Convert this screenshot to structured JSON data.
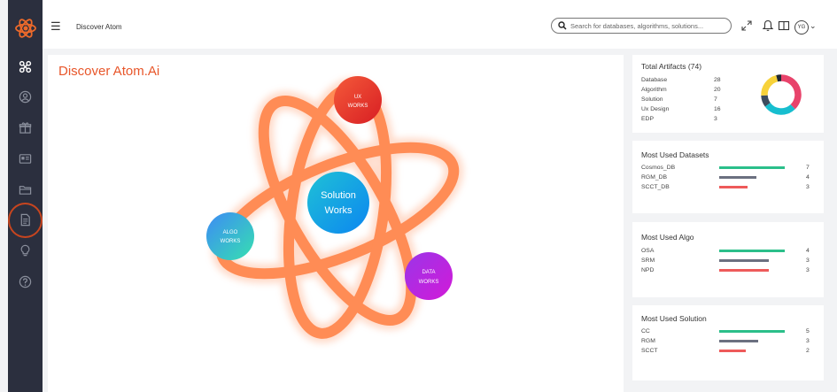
{
  "header": {
    "breadcrumb": "Discover Atom",
    "search_placeholder": "Search for databases, algorithms, solutions...",
    "avatar_initials": "YG"
  },
  "main": {
    "title": "Discover Atom.Ai",
    "nodes": {
      "center": [
        "Solution",
        "Works"
      ],
      "ux": [
        "UX",
        "WORKS"
      ],
      "algo": [
        "ALGO",
        "WORKS"
      ],
      "data": [
        "DATA",
        "WORKS"
      ]
    }
  },
  "artifacts": {
    "title": "Total Artifacts (74)",
    "items": [
      {
        "label": "Database",
        "value": "28",
        "color": "#e8436b"
      },
      {
        "label": "Algorithm",
        "value": "20",
        "color": "#17becf"
      },
      {
        "label": "Solution",
        "value": "7",
        "color": "#3c4c5e"
      },
      {
        "label": "Ux Design",
        "value": "16",
        "color": "#f7d23a"
      },
      {
        "label": "EDP",
        "value": "3",
        "color": "#1f2833"
      }
    ]
  },
  "datasets": {
    "title": "Most Used Datasets",
    "items": [
      {
        "label": "Cosmos_DB",
        "value": "7",
        "color": "#2bbf8a"
      },
      {
        "label": "RGM_DB",
        "value": "4",
        "color": "#6b7080"
      },
      {
        "label": "SCCT_DB",
        "value": "3",
        "color": "#ee5a5a"
      }
    ]
  },
  "algo": {
    "title": "Most Used Algo",
    "items": [
      {
        "label": "OSA",
        "value": "4",
        "color": "#2bbf8a"
      },
      {
        "label": "SRM",
        "value": "3",
        "color": "#6b7080"
      },
      {
        "label": "NPD",
        "value": "3",
        "color": "#ee5a5a"
      }
    ]
  },
  "solution": {
    "title": "Most Used Solution",
    "items": [
      {
        "label": "CC",
        "value": "5",
        "color": "#2bbf8a"
      },
      {
        "label": "RGM",
        "value": "3",
        "color": "#6b7080"
      },
      {
        "label": "SCCT",
        "value": "2",
        "color": "#ee5a5a"
      }
    ]
  },
  "sidebar": {
    "icons": [
      "molecule-icon",
      "user-circle-icon",
      "gift-icon",
      "id-card-icon",
      "folder-icon",
      "document-icon",
      "lightbulb-icon",
      "help-icon"
    ],
    "active": "document-icon"
  }
}
